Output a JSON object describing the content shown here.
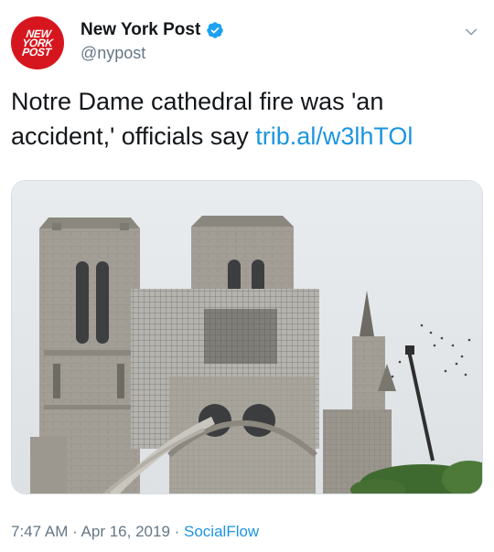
{
  "header": {
    "avatar_text": [
      "NEW",
      "YORK",
      "POST"
    ],
    "display_name": "New York Post",
    "handle": "@nypost",
    "verified": true
  },
  "tweet": {
    "text": "Notre Dame cathedral fire was 'an accident,' officials say ",
    "link": "trib.al/w3lhTOl"
  },
  "media": {
    "icon": "photo-of-notre-dame-cathedral"
  },
  "meta": {
    "time": "7:47 AM",
    "separator1": " · ",
    "date": "Apr 16, 2019",
    "separator2": " · ",
    "source": "SocialFlow"
  },
  "colors": {
    "brand_red": "#d6161e",
    "link_blue": "#1b95e0",
    "muted_gray": "#657786"
  }
}
